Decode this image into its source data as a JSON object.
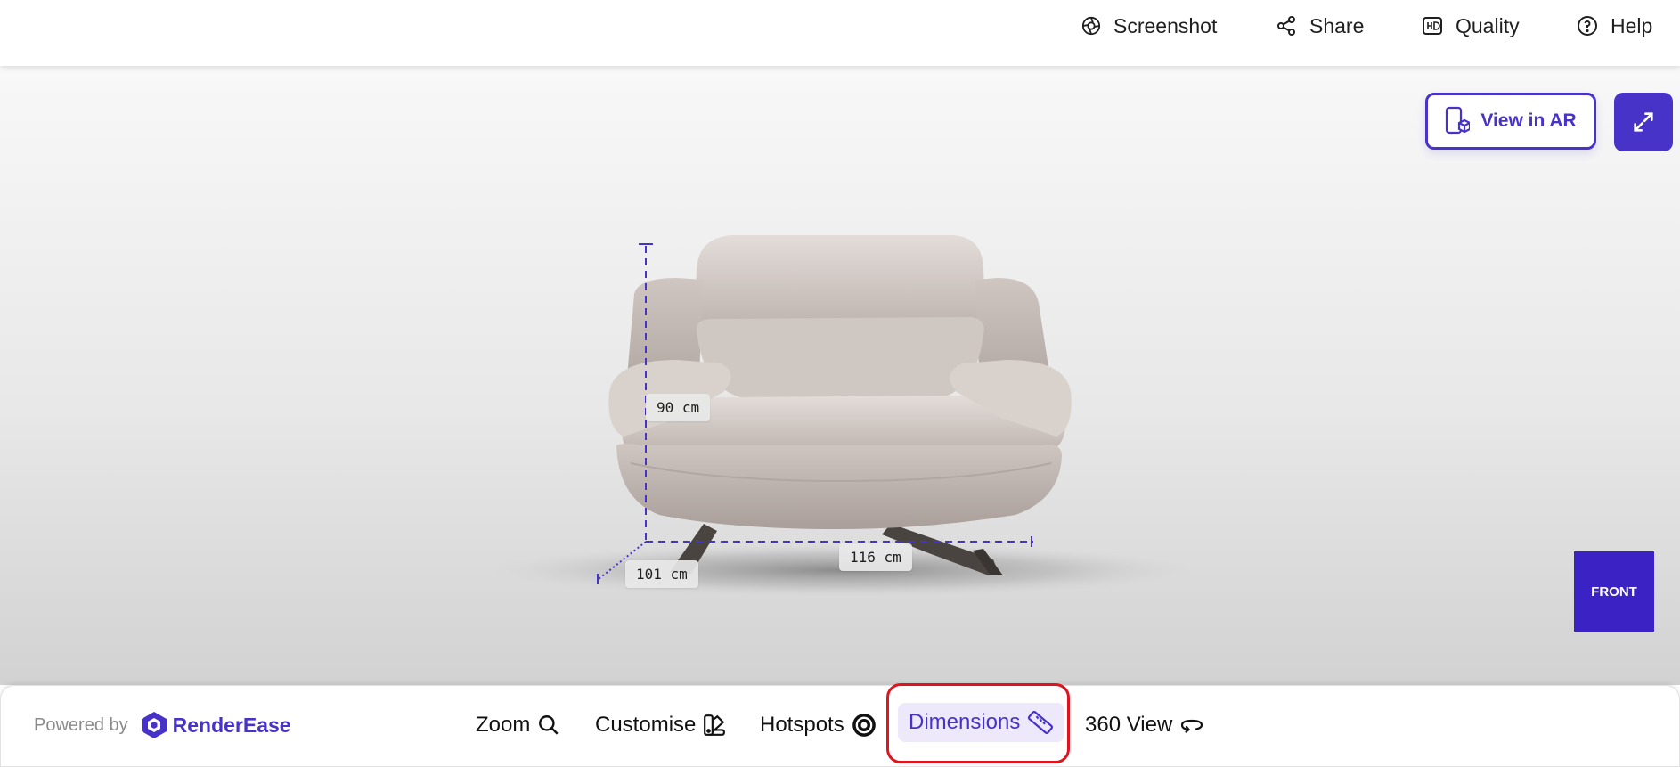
{
  "toolbar": {
    "screenshot": "Screenshot",
    "share": "Share",
    "quality": "Quality",
    "help": "Help"
  },
  "viewer": {
    "view_in_ar": "View in AR",
    "front_label": "FRONT",
    "dimensions": {
      "height": "90 cm",
      "width": "116 cm",
      "depth": "101 cm"
    }
  },
  "footer": {
    "powered_by": "Powered by",
    "brand": "RenderEase",
    "tools": {
      "zoom": "Zoom",
      "customise": "Customise",
      "hotspots": "Hotspots",
      "dimensions": "Dimensions",
      "view360": "360 View"
    },
    "active_tool": "dimensions"
  },
  "icons": {
    "screenshot": "shutter-icon",
    "share": "share-icon",
    "quality": "hd-icon",
    "help": "help-icon",
    "ar": "phone-cube-icon",
    "expand": "expand-icon",
    "zoom": "search-icon",
    "customise": "palette-icon",
    "hotspots": "target-icon",
    "dimensions": "ruler-icon",
    "view360": "rotate-icon"
  },
  "colors": {
    "accent": "#4733c7",
    "front_button": "#3b22c4",
    "highlight": "#e0141e"
  }
}
